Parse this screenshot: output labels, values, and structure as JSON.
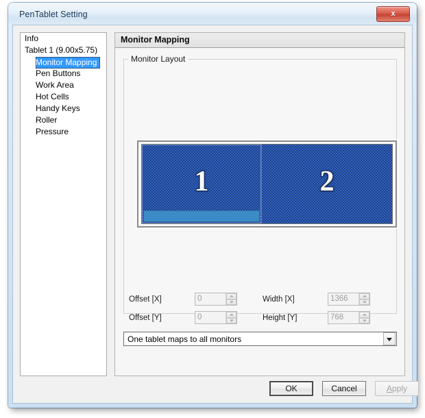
{
  "window": {
    "title": "PenTablet Setting",
    "close_icon": "close-x-icon",
    "close_label": "x"
  },
  "sidebar": {
    "items": [
      {
        "label": "Info",
        "level": 1,
        "selected": false
      },
      {
        "label": "Tablet  1 (9.00x5.75)",
        "level": 1,
        "selected": false
      },
      {
        "label": "Monitor Mapping",
        "level": 2,
        "selected": true
      },
      {
        "label": "Pen Buttons",
        "level": 2,
        "selected": false
      },
      {
        "label": "Work Area",
        "level": 2,
        "selected": false
      },
      {
        "label": "Hot Cells",
        "level": 2,
        "selected": false
      },
      {
        "label": "Handy Keys",
        "level": 2,
        "selected": false
      },
      {
        "label": "Roller",
        "level": 2,
        "selected": false
      },
      {
        "label": "Pressure",
        "level": 2,
        "selected": false
      }
    ]
  },
  "main": {
    "panel_title": "Monitor Mapping",
    "group_legend": "Monitor Layout",
    "monitors": [
      {
        "number": "1",
        "has_taskbar": true
      },
      {
        "number": "2",
        "has_taskbar": false
      }
    ],
    "fields": {
      "offset_x_label": "Offset [X]",
      "offset_x_value": "0",
      "offset_y_label": "Offset [Y]",
      "offset_y_value": "0",
      "width_x_label": "Width [X]",
      "width_x_value": "1366",
      "height_y_label": "Height [Y]",
      "height_y_value": "768"
    },
    "mapping_combo": {
      "selected": "One tablet maps to all monitors",
      "arrow_icon": "chevron-down-icon"
    }
  },
  "buttons": {
    "ok": "OK",
    "cancel": "Cancel",
    "apply_accel": "A",
    "apply_rest": "pply"
  },
  "colors": {
    "selection_blue": "#3399ff",
    "monitor_blue": "#2f62bd",
    "taskbar_blue": "#3b8cc6",
    "close_red": "#c34535",
    "frame_blue": "#cadff1"
  }
}
